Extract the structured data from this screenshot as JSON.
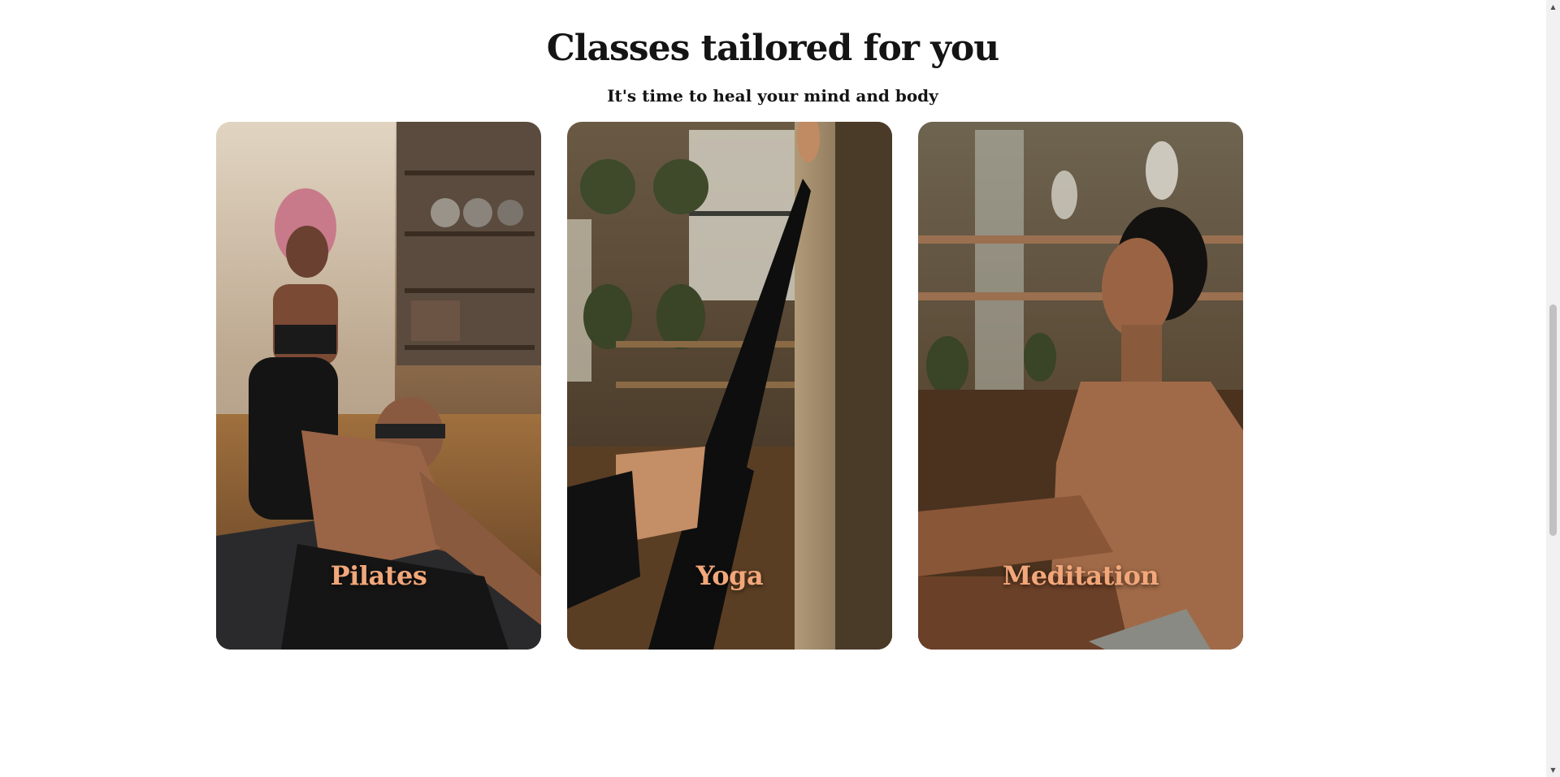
{
  "section": {
    "title": "Classes tailored for you",
    "subtitle": "It's time to heal your mind and body"
  },
  "classes": [
    {
      "label": "Pilates"
    },
    {
      "label": "Yoga"
    },
    {
      "label": "Meditation"
    }
  ],
  "colors": {
    "heading": "#141414",
    "card_label": "#f2a77a",
    "background": "#ffffff"
  },
  "icons": {
    "scroll_up": "scroll-up-arrow-icon",
    "scroll_down": "scroll-down-arrow-icon"
  }
}
